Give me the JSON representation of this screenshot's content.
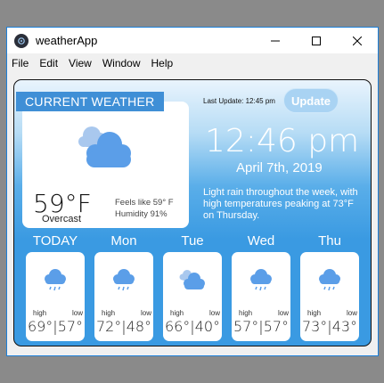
{
  "window": {
    "title": "weatherApp",
    "controls": {
      "minimize": "—",
      "maximize": "☐",
      "close": "✕"
    }
  },
  "menu": [
    "File",
    "Edit",
    "View",
    "Window",
    "Help"
  ],
  "current": {
    "tab_label": "CURRENT WEATHER",
    "icon": "partly-cloudy-icon",
    "temperature": "59°F",
    "condition": "Overcast",
    "feels_like": "Feels like 59° F",
    "humidity": "Humidity 91%"
  },
  "header": {
    "last_update": "Last Update: 12:45 pm",
    "update_button": "Update",
    "time": "12:46 pm",
    "date": "April 7th, 2019",
    "summary": "Light rain throughout the week, with high temperatures peaking at 73°F on Thursday."
  },
  "forecast": [
    {
      "day": "TODAY",
      "icon": "rain-icon",
      "high_label": "high",
      "low_label": "low",
      "values": "69°|57°"
    },
    {
      "day": "Mon",
      "icon": "rain-icon",
      "high_label": "high",
      "low_label": "low",
      "values": "72°|48°"
    },
    {
      "day": "Tue",
      "icon": "partly-cloudy-icon",
      "high_label": "high",
      "low_label": "low",
      "values": "66°|40°"
    },
    {
      "day": "Wed",
      "icon": "rain-icon",
      "high_label": "high",
      "low_label": "low",
      "values": "57°|57°"
    },
    {
      "day": "Thu",
      "icon": "rain-icon",
      "high_label": "high",
      "low_label": "low",
      "values": "73°|43°"
    }
  ],
  "colors": {
    "accent": "#3f8fd6",
    "cloud": "#5b9ee8",
    "window_border": "#1c7fd8"
  }
}
